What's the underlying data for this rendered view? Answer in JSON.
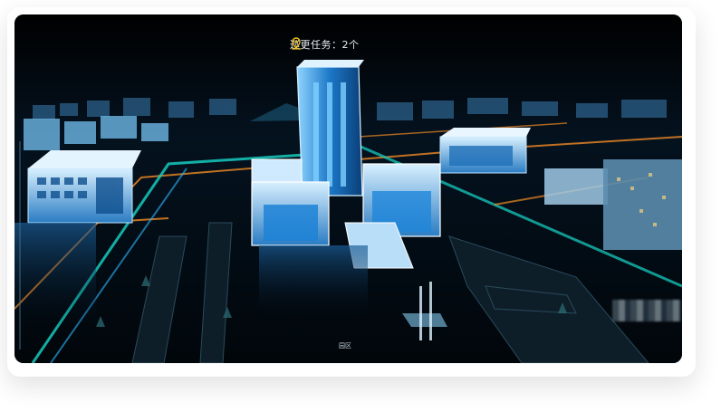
{
  "task_banner": {
    "text": "巡更任务：2个",
    "icon": "location-pin-icon"
  },
  "map": {
    "zone_label": "园区",
    "faint_caption": "",
    "left_scale_top": "",
    "left_scale_bottom": ""
  },
  "colors": {
    "glow": "#2fb6ff",
    "road": "#f08a24",
    "teal": "#18d6c8",
    "accent": "#f2c21b"
  }
}
